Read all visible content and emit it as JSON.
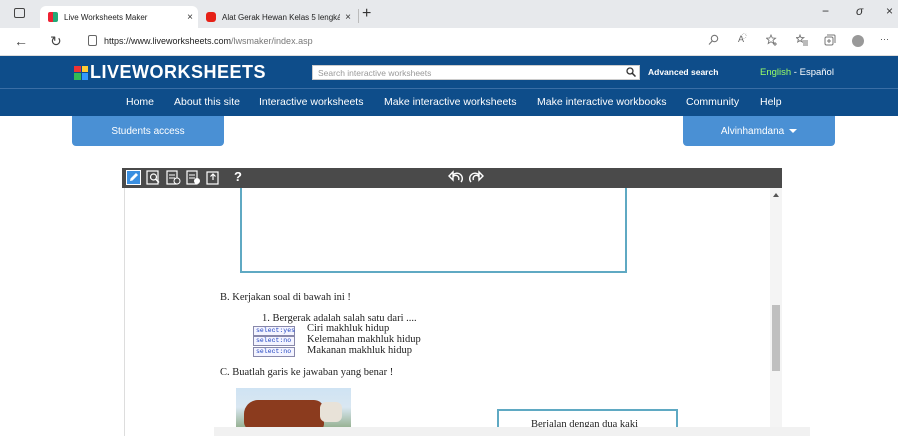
{
  "browser": {
    "tabs": [
      {
        "title": "Live Worksheets Maker",
        "close": "×"
      },
      {
        "title": "Alat Gerak Hewan Kelas 5 lengká",
        "close": "×"
      }
    ],
    "new_tab": "+",
    "window_controls": {
      "minimize": "−",
      "restore": "σ",
      "close": "×"
    },
    "url_host": "https://www.liveworksheets.com",
    "url_path": "/lwsmaker/index.asp",
    "more": "···"
  },
  "site": {
    "logo": "LIVEWORKSHEETS",
    "search_placeholder": "Search interactive worksheets",
    "advanced_search": "Advanced search",
    "lang_en": "English",
    "lang_sep": " - ",
    "lang_es": "Español",
    "nav": [
      "Home",
      "About this site",
      "Interactive worksheets",
      "Make interactive worksheets",
      "Make interactive workbooks",
      "Community",
      "Help"
    ],
    "students_access": "Students access",
    "user": "Alvinhamdana"
  },
  "editor": {
    "help": "?"
  },
  "document": {
    "section_b": "B.   Kerjakan soal di bawah ini !",
    "question_1": "1.   Bergerak adalah salah satu dari ....",
    "options": [
      {
        "select": "select:yes",
        "text": "Ciri makhluk hidup"
      },
      {
        "select": "select:no",
        "text": "Kelemahan makhluk hidup"
      },
      {
        "select": "select:no",
        "text": "Makanan makhluk hidup"
      }
    ],
    "section_c": "C.   Buatlah garis ke jawaban yang benar !",
    "match_box_text": "Berjalan dengan dua kaki"
  }
}
